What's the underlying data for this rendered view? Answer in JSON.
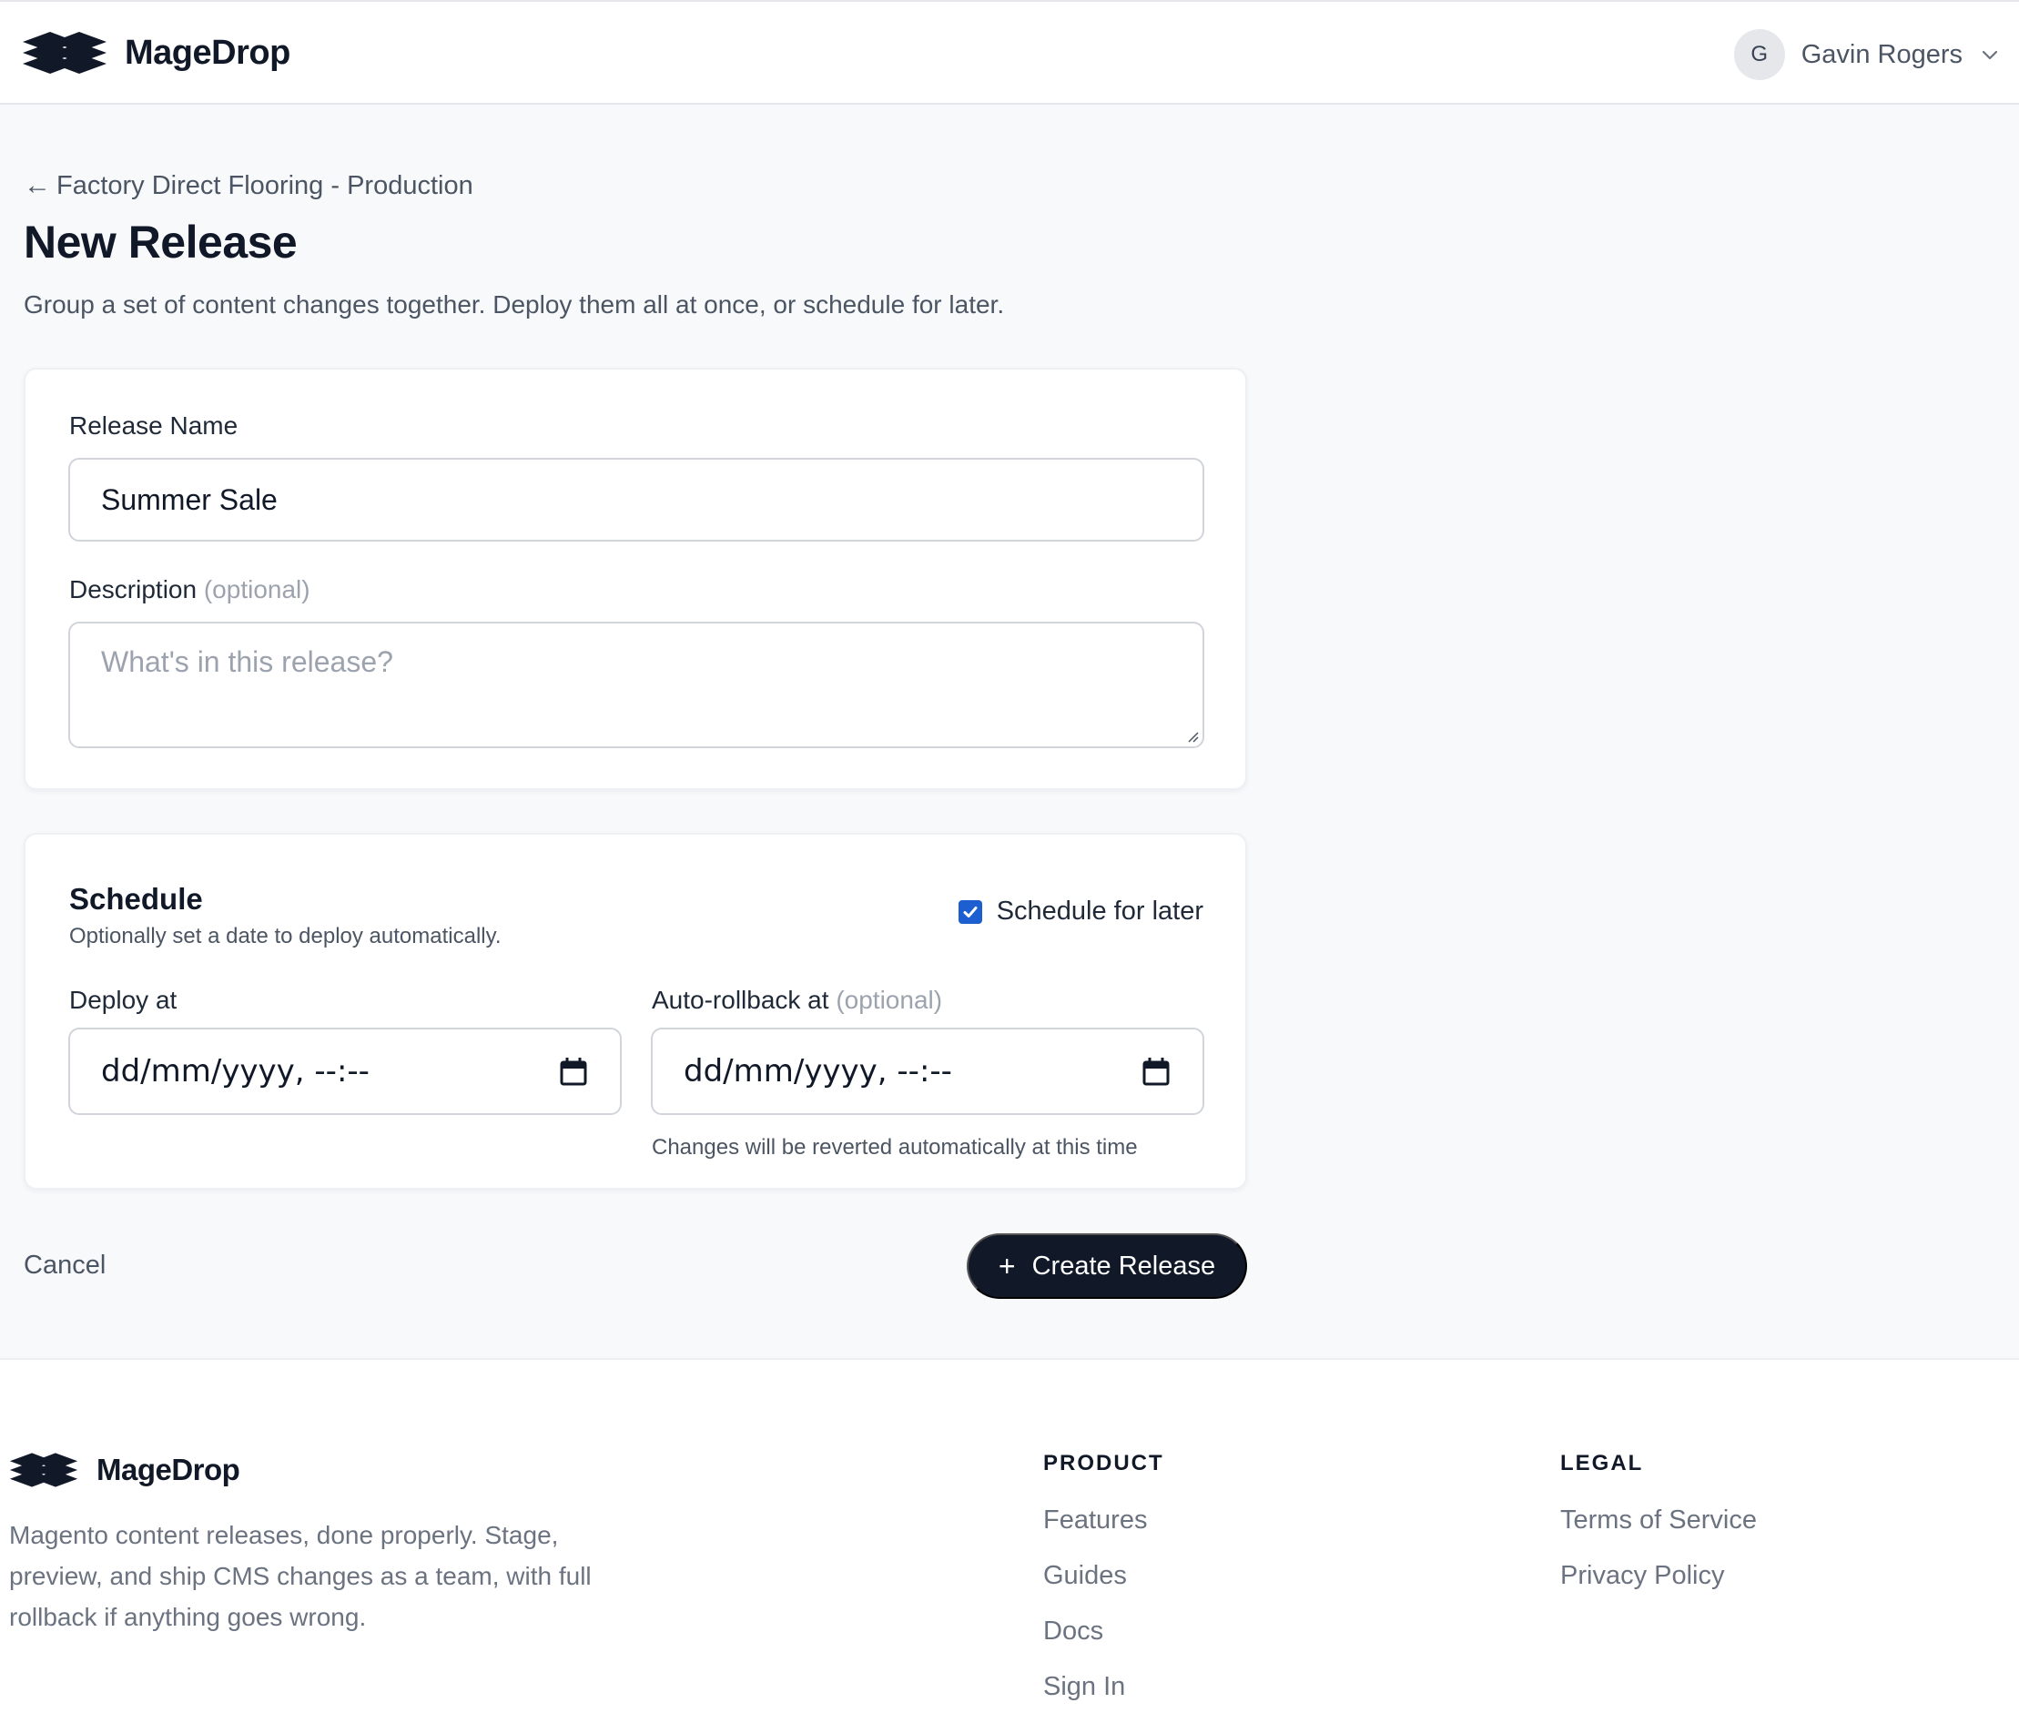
{
  "header": {
    "brand_name": "MageDrop",
    "user": {
      "initial": "G",
      "name": "Gavin Rogers"
    }
  },
  "page": {
    "back_link": "Factory Direct Flooring - Production",
    "title": "New Release",
    "subtitle": "Group a set of content changes together. Deploy them all at once, or schedule for later."
  },
  "details": {
    "release_name_label": "Release Name",
    "release_name_value": "Summer Sale",
    "description_label": "Description",
    "description_optional": "(optional)",
    "description_placeholder": "What's in this release?"
  },
  "schedule": {
    "title": "Schedule",
    "subtitle": "Optionally set a date to deploy automatically.",
    "checkbox_label": "Schedule for later",
    "checkbox_checked": true,
    "deploy_label": "Deploy at",
    "deploy_value": "dd/mm/yyyy, --:--",
    "rollback_label": "Auto-rollback at",
    "rollback_optional": "(optional)",
    "rollback_value": "dd/mm/yyyy, --:--",
    "rollback_help": "Changes will be reverted automatically at this time"
  },
  "actions": {
    "cancel_label": "Cancel",
    "create_label": "Create Release"
  },
  "footer": {
    "brand_name": "MageDrop",
    "tagline": "Magento content releases, done properly. Stage, preview, and ship CMS changes as a team, with full rollback if anything goes wrong.",
    "product": {
      "title": "PRODUCT",
      "links": [
        "Features",
        "Guides",
        "Docs",
        "Sign In"
      ]
    },
    "legal": {
      "title": "LEGAL",
      "links": [
        "Terms of Service",
        "Privacy Policy"
      ]
    }
  },
  "colors": {
    "primary_dark": "#111827",
    "checkbox_blue": "#1d5fd1",
    "page_bg": "#f8f9fb"
  }
}
